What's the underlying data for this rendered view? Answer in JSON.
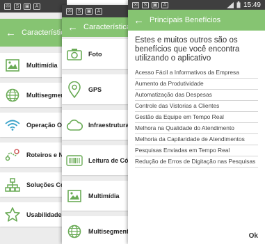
{
  "screen1": {
    "status_icons": [
      "✉",
      "S",
      "▣",
      "A"
    ],
    "title": "Características Téc",
    "items": [
      {
        "label": "Multimídia",
        "icon": "image-icon"
      },
      {
        "label": "Multisegmento",
        "icon": "globe-icon"
      },
      {
        "label": "Operação On-line",
        "icon": "wifi-icon"
      },
      {
        "label": "Roteiros e Navega",
        "icon": "route-icon"
      },
      {
        "label": "Soluções Corpora",
        "icon": "org-chart-icon"
      },
      {
        "label": "Usabilidade",
        "icon": "star-icon"
      }
    ]
  },
  "screen2": {
    "status_icons": [
      "✉",
      "S",
      "▣",
      "A"
    ],
    "title": "Características Téc",
    "items": [
      {
        "label": "Foto",
        "icon": "camera-icon"
      },
      {
        "label": "GPS",
        "icon": "location-pin-icon"
      },
      {
        "label": "Infraestrutura",
        "icon": "cloud-icon"
      },
      {
        "label": "Leitura de Código",
        "icon": "barcode-icon"
      },
      {
        "label": "Multimídia",
        "icon": "image-icon"
      },
      {
        "label": "Multisegmento",
        "icon": "globe-icon"
      }
    ]
  },
  "screen3": {
    "status_icons": [
      "✉",
      "S",
      "▣",
      "A"
    ],
    "time": "15:49",
    "title": "Principais Benefícios",
    "intro": "Estes e muitos outros são os benefícios que você encontra utilizando o aplicativo",
    "benefits": [
      "Acesso Fácil a Informativos da Empresa",
      "Aumento da Produtividade",
      "Automatização das Despesas",
      "Controle das Vistorias a Clientes",
      "Gestão da Equipe em Tempo Real",
      "Melhora na Qualidade do Atendimento",
      "Melhoria da Capilaridade de Atendimentos",
      "Pesquisas Enviadas em Tempo Real",
      "Redução de Erros de Digitação nas Pesquisas"
    ],
    "ok_label": "Ok"
  },
  "colors": {
    "accent": "#86c472",
    "icon": "#6aab56",
    "statusbar": "#3f3f3f"
  }
}
